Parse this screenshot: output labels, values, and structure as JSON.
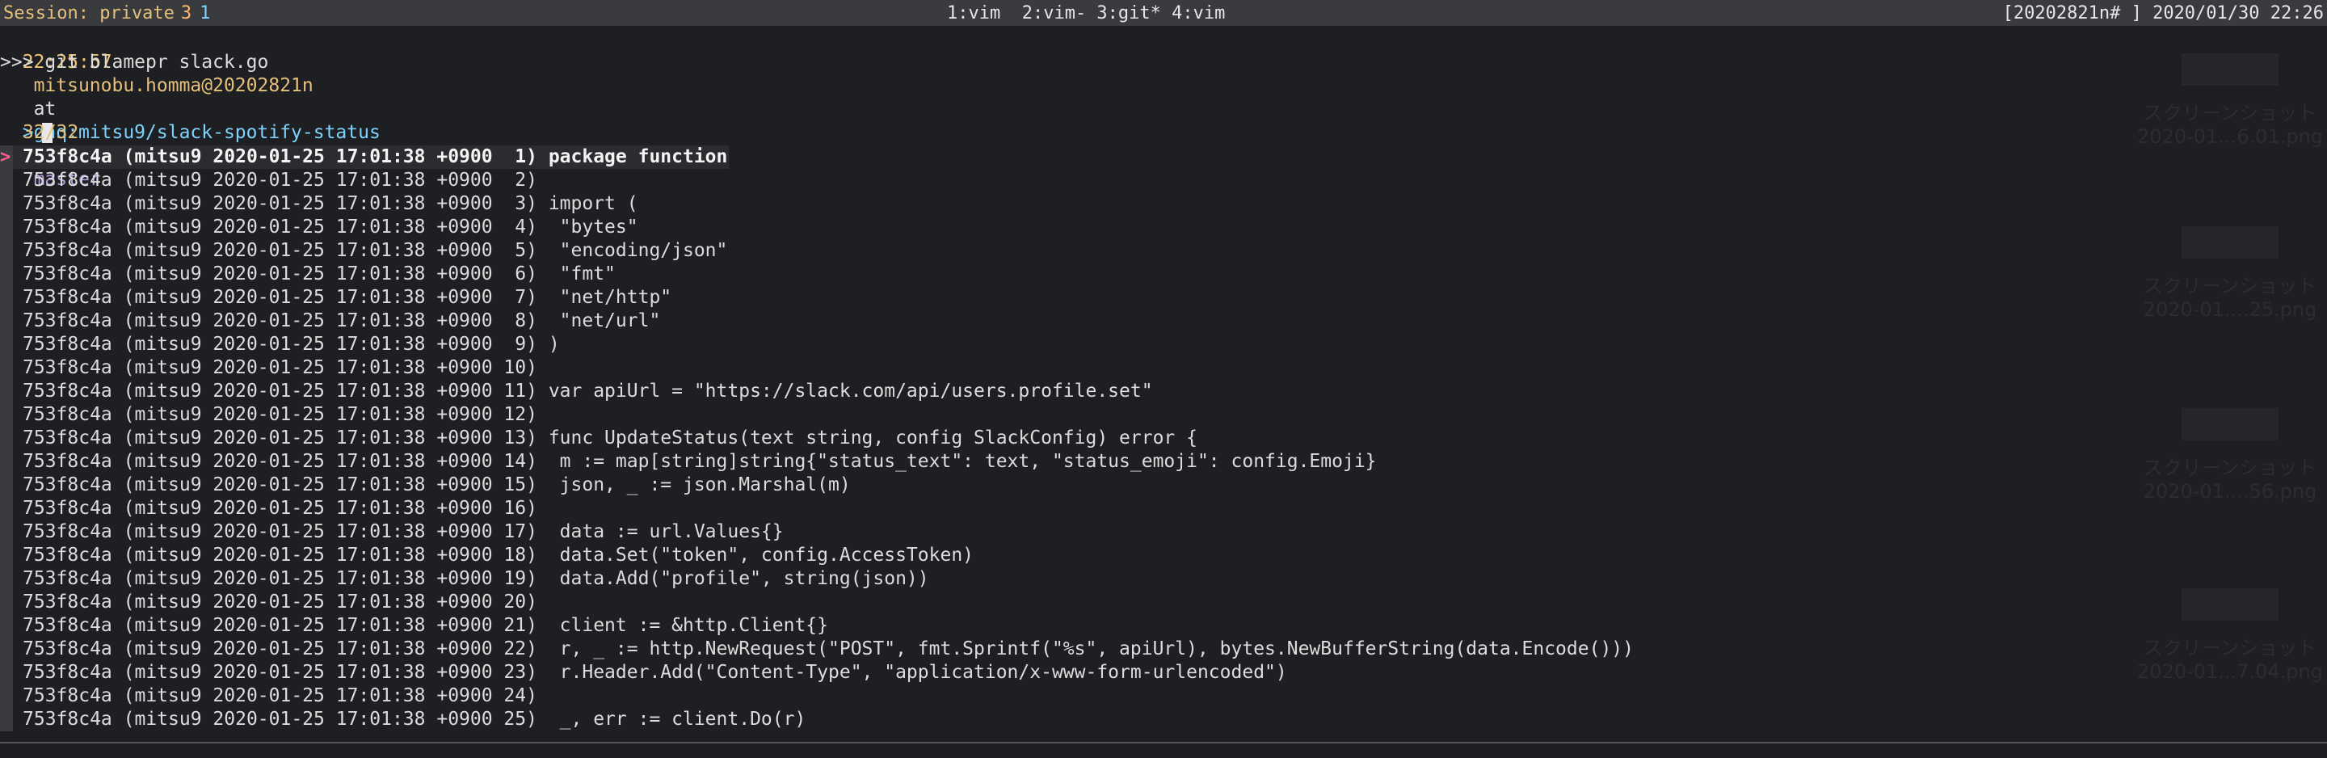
{
  "statusbar": {
    "session_label": "Session: private",
    "session_num": "3",
    "session_num2": "1",
    "windows": "1:vim  2:vim- 3:git* 4:vim",
    "right": "[20202821n# ] 2020/01/30 22:26"
  },
  "prompt": {
    "time": "22:25:57",
    "user_host": "mitsunobu.homma@20202821n",
    "at": "at",
    "repo": "ghq:mitsu9/slack-spotify-status",
    "on": "on",
    "branch": "master",
    "command": ">>> git blamepr slack.go"
  },
  "fzf": {
    "caret": ">",
    "counter": "32/32",
    "pointer": ">"
  },
  "blame_lines": [
    "753f8c4a (mitsu9 2020-01-25 17:01:38 +0900  1) package function",
    "753f8c4a (mitsu9 2020-01-25 17:01:38 +0900  2)",
    "753f8c4a (mitsu9 2020-01-25 17:01:38 +0900  3) import (",
    "753f8c4a (mitsu9 2020-01-25 17:01:38 +0900  4)  \"bytes\"",
    "753f8c4a (mitsu9 2020-01-25 17:01:38 +0900  5)  \"encoding/json\"",
    "753f8c4a (mitsu9 2020-01-25 17:01:38 +0900  6)  \"fmt\"",
    "753f8c4a (mitsu9 2020-01-25 17:01:38 +0900  7)  \"net/http\"",
    "753f8c4a (mitsu9 2020-01-25 17:01:38 +0900  8)  \"net/url\"",
    "753f8c4a (mitsu9 2020-01-25 17:01:38 +0900  9) )",
    "753f8c4a (mitsu9 2020-01-25 17:01:38 +0900 10)",
    "753f8c4a (mitsu9 2020-01-25 17:01:38 +0900 11) var apiUrl = \"https://slack.com/api/users.profile.set\"",
    "753f8c4a (mitsu9 2020-01-25 17:01:38 +0900 12)",
    "753f8c4a (mitsu9 2020-01-25 17:01:38 +0900 13) func UpdateStatus(text string, config SlackConfig) error {",
    "753f8c4a (mitsu9 2020-01-25 17:01:38 +0900 14)  m := map[string]string{\"status_text\": text, \"status_emoji\": config.Emoji}",
    "753f8c4a (mitsu9 2020-01-25 17:01:38 +0900 15)  json, _ := json.Marshal(m)",
    "753f8c4a (mitsu9 2020-01-25 17:01:38 +0900 16)",
    "753f8c4a (mitsu9 2020-01-25 17:01:38 +0900 17)  data := url.Values{}",
    "753f8c4a (mitsu9 2020-01-25 17:01:38 +0900 18)  data.Set(\"token\", config.AccessToken)",
    "753f8c4a (mitsu9 2020-01-25 17:01:38 +0900 19)  data.Add(\"profile\", string(json))",
    "753f8c4a (mitsu9 2020-01-25 17:01:38 +0900 20)",
    "753f8c4a (mitsu9 2020-01-25 17:01:38 +0900 21)  client := &http.Client{}",
    "753f8c4a (mitsu9 2020-01-25 17:01:38 +0900 22)  r, _ := http.NewRequest(\"POST\", fmt.Sprintf(\"%s\", apiUrl), bytes.NewBufferString(data.Encode()))",
    "753f8c4a (mitsu9 2020-01-25 17:01:38 +0900 23)  r.Header.Add(\"Content-Type\", \"application/x-www-form-urlencoded\")",
    "753f8c4a (mitsu9 2020-01-25 17:01:38 +0900 24)",
    "753f8c4a (mitsu9 2020-01-25 17:01:38 +0900 25)  _, err := client.Do(r)"
  ],
  "desktop": [
    {
      "line1": "スクリーンショット",
      "line2": "2020-01...6.01.png"
    },
    {
      "line1": "スクリーンショット",
      "line2": "2020-01....25.png"
    },
    {
      "line1": "スクリーンショット",
      "line2": "2020-01....56.png"
    },
    {
      "line1": "スクリーンショット",
      "line2": "2020-01...7.04.png"
    }
  ]
}
